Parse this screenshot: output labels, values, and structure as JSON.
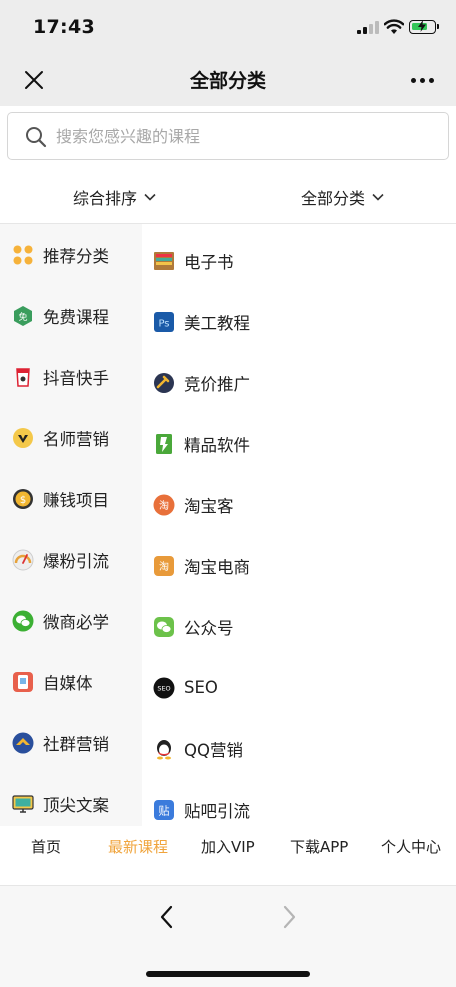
{
  "status_bar": {
    "time": "17:43"
  },
  "nav": {
    "title": "全部分类",
    "close_icon": "close-icon",
    "more_icon": "more-dots-icon"
  },
  "search": {
    "placeholder": "搜索您感兴趣的课程",
    "value": ""
  },
  "filters": {
    "sort_label": "综合排序",
    "category_label": "全部分类"
  },
  "categories": [
    {
      "label": "推荐分类",
      "icon": "recommend-icon",
      "active": true
    },
    {
      "label": "免费课程",
      "icon": "free-icon"
    },
    {
      "label": "抖音快手",
      "icon": "douyin-icon"
    },
    {
      "label": "名师营销",
      "icon": "teacher-icon"
    },
    {
      "label": "赚钱项目",
      "icon": "money-icon"
    },
    {
      "label": "爆粉引流",
      "icon": "gauge-icon"
    },
    {
      "label": "微商必学",
      "icon": "wechat-icon"
    },
    {
      "label": "自媒体",
      "icon": "media-icon"
    },
    {
      "label": "社群营销",
      "icon": "community-icon"
    },
    {
      "label": "顶尖文案",
      "icon": "monitor-icon"
    }
  ],
  "subcategories": [
    {
      "label": "电子书",
      "icon": "ebook-icon"
    },
    {
      "label": "美工教程",
      "icon": "photoshop-icon"
    },
    {
      "label": "竞价推广",
      "icon": "bid-icon"
    },
    {
      "label": "精品软件",
      "icon": "software-icon"
    },
    {
      "label": "淘宝客",
      "icon": "taobaoke-icon"
    },
    {
      "label": "淘宝电商",
      "icon": "taobao-icon"
    },
    {
      "label": "公众号",
      "icon": "official-account-icon"
    },
    {
      "label": "SEO",
      "icon": "seo-icon"
    },
    {
      "label": "QQ营销",
      "icon": "qq-icon"
    },
    {
      "label": "贴吧引流",
      "icon": "tieba-icon"
    }
  ],
  "bottom_tabs": [
    {
      "label": "首页"
    },
    {
      "label": "最新课程",
      "active": true
    },
    {
      "label": "加入VIP"
    },
    {
      "label": "下载APP"
    },
    {
      "label": "个人中心"
    }
  ],
  "colors": {
    "accent_red": "#e03a2e",
    "tab_active": "#f0a43c",
    "battery_green": "#34c759"
  }
}
